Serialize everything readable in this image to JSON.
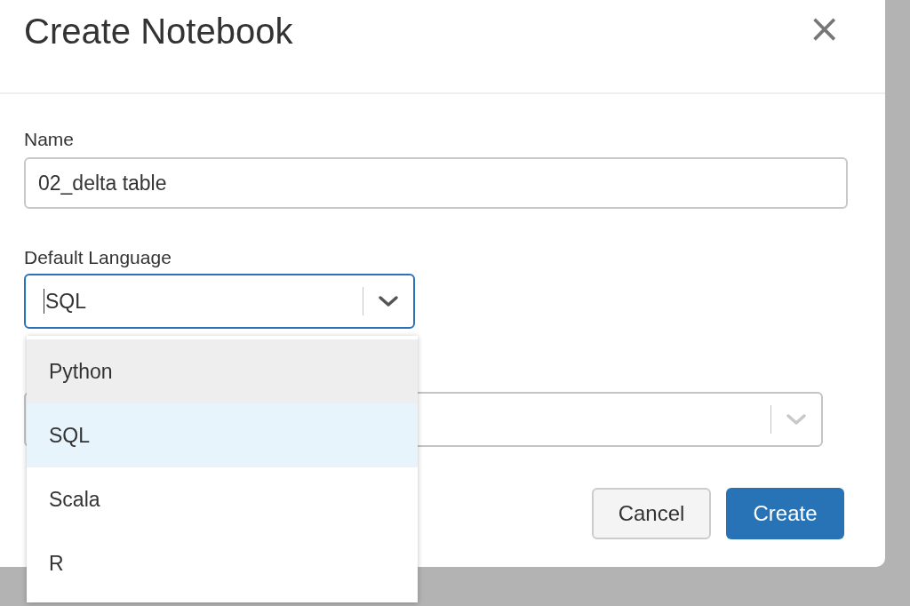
{
  "dialog": {
    "title": "Create Notebook",
    "close_icon": "×"
  },
  "name_field": {
    "label": "Name",
    "value": "02_delta table"
  },
  "language_field": {
    "label": "Default Language",
    "value": "SQL",
    "focused": true,
    "expanded": true,
    "options": [
      {
        "label": "Python",
        "highlighted": true,
        "selected": false
      },
      {
        "label": "SQL",
        "highlighted": false,
        "selected": true
      },
      {
        "label": "Scala",
        "highlighted": false,
        "selected": false
      },
      {
        "label": "R",
        "highlighted": false,
        "selected": false
      }
    ]
  },
  "buttons": [
    {
      "label": "Cancel",
      "kind": "secondary"
    },
    {
      "label": "Create",
      "kind": "primary"
    }
  ]
}
